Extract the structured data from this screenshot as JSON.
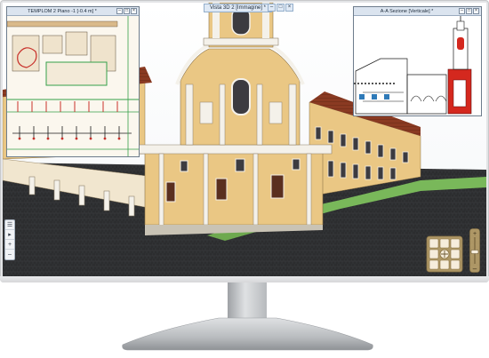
{
  "view3d": {
    "title": "Vista 3D 2 [Immagine] *"
  },
  "plan_window": {
    "title": "TEMPLOM 2 Piano -1 [-0.4 m] *",
    "buttons": {
      "minimize": "–",
      "maximize": "□",
      "close": "×"
    }
  },
  "section_window": {
    "title": "A-A Sezione [Verticale] *",
    "buttons": {
      "minimize": "–",
      "maximize": "□",
      "close": "×"
    }
  },
  "main_window_buttons": {
    "minimize": "–",
    "maximize": "□",
    "close": "×"
  },
  "left_toolbar": {
    "items": [
      {
        "icon": "list-icon",
        "glyph": "☰"
      },
      {
        "icon": "arrow-right-icon",
        "glyph": "▸"
      },
      {
        "icon": "plus-icon",
        "glyph": "+"
      },
      {
        "icon": "minus-icon",
        "glyph": "–"
      }
    ]
  },
  "navigation": {
    "zoom_plus": "+",
    "zoom_minus": "–",
    "zoom_level": 0.55
  },
  "colors": {
    "facade": "#eac784",
    "roof": "#8a3a22",
    "trim": "#f4f1ea",
    "pavement": "#2b2c2e",
    "lawn": "#79b85a",
    "section_red": "#d4281e",
    "plan_green": "#36a04a",
    "plan_red": "#c8302a"
  }
}
